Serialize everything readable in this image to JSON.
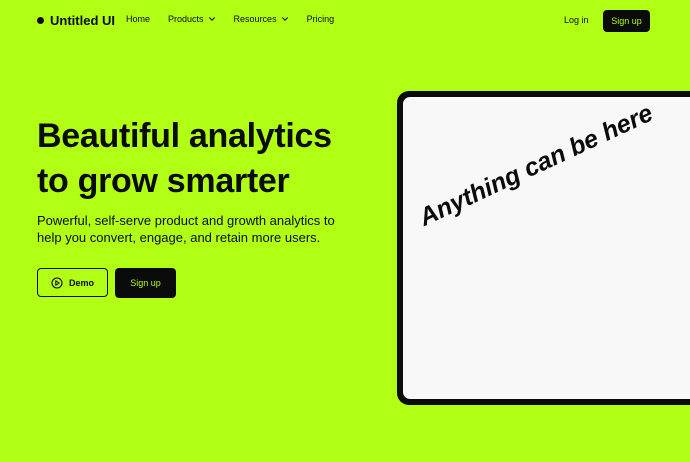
{
  "brand": {
    "name": "Untitled UI"
  },
  "nav": {
    "items": [
      {
        "label": "Home"
      },
      {
        "label": "Products"
      },
      {
        "label": "Resources"
      },
      {
        "label": "Pricing"
      }
    ],
    "login_label": "Log in",
    "signup_label": "Sign up"
  },
  "hero": {
    "headline_line1": "Beautiful analytics",
    "headline_line2": "to grow smarter",
    "subhead": "Powerful, self-serve product and growth analytics to help you convert, engage, and retain more users.",
    "demo_label": "Demo",
    "signup_label": "Sign up"
  },
  "device": {
    "screen_text": "Anything can be here"
  },
  "colors": {
    "accent": "#b0ff14",
    "ink": "#0b0b0b",
    "screen": "#f8f8f8"
  }
}
